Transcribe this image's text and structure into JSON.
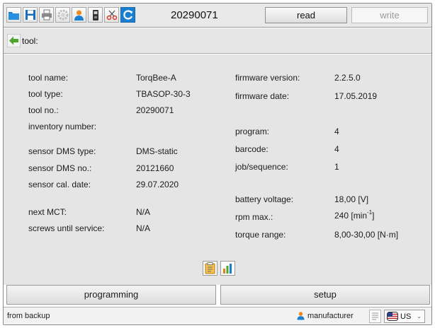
{
  "toolbar": {
    "serial": "20290071",
    "read_label": "read",
    "write_label": "write",
    "icons": [
      "folder-icon",
      "save-icon",
      "print-icon",
      "gear-icon",
      "user-icon",
      "device-icon",
      "cut-icon",
      "refresh-icon"
    ]
  },
  "breadcrumb": {
    "label": "tool:",
    "icon": "back-arrow-icon"
  },
  "info_left": [
    {
      "label": "tool name:",
      "value": "TorqBee-A"
    },
    {
      "label": "tool type:",
      "value": "TBASOP-30-3"
    },
    {
      "label": "tool no.:",
      "value": "20290071"
    },
    {
      "label": "inventory number:",
      "value": ""
    },
    {
      "label": "sensor DMS type:",
      "value": "DMS-static"
    },
    {
      "label": "sensor DMS no.:",
      "value": "20121660"
    },
    {
      "label": "sensor cal. date:",
      "value": "29.07.2020"
    },
    {
      "label": "next MCT:",
      "value": "N/A"
    },
    {
      "label": "screws until service:",
      "value": "N/A"
    }
  ],
  "info_right": [
    {
      "label": "firmware version:",
      "value": "2.2.5.0"
    },
    {
      "label": "firmware date:",
      "value": "17.05.2019"
    },
    {
      "label": "program:",
      "value": "4"
    },
    {
      "label": "barcode:",
      "value": "4"
    },
    {
      "label": "job/sequence:",
      "value": "1"
    },
    {
      "label": "battery voltage:",
      "value": "18,00 [V]"
    },
    {
      "label": "rpm max.:",
      "value_prefix": "240 [min",
      "value_sup": "-1",
      "value_suffix": "]"
    },
    {
      "label": "torque range:",
      "value": "8,00-30,00 [N·m]"
    }
  ],
  "panel_icons": [
    "clipboard-icon",
    "bar-chart-icon"
  ],
  "buttons": {
    "programming": "programming",
    "setup": "setup"
  },
  "status": {
    "left": "from backup",
    "user": "manufacturer",
    "language": "US"
  },
  "colors": {
    "accent_blue": "#1b7fcf",
    "orange": "#f08a1c",
    "green": "#5aa332"
  }
}
